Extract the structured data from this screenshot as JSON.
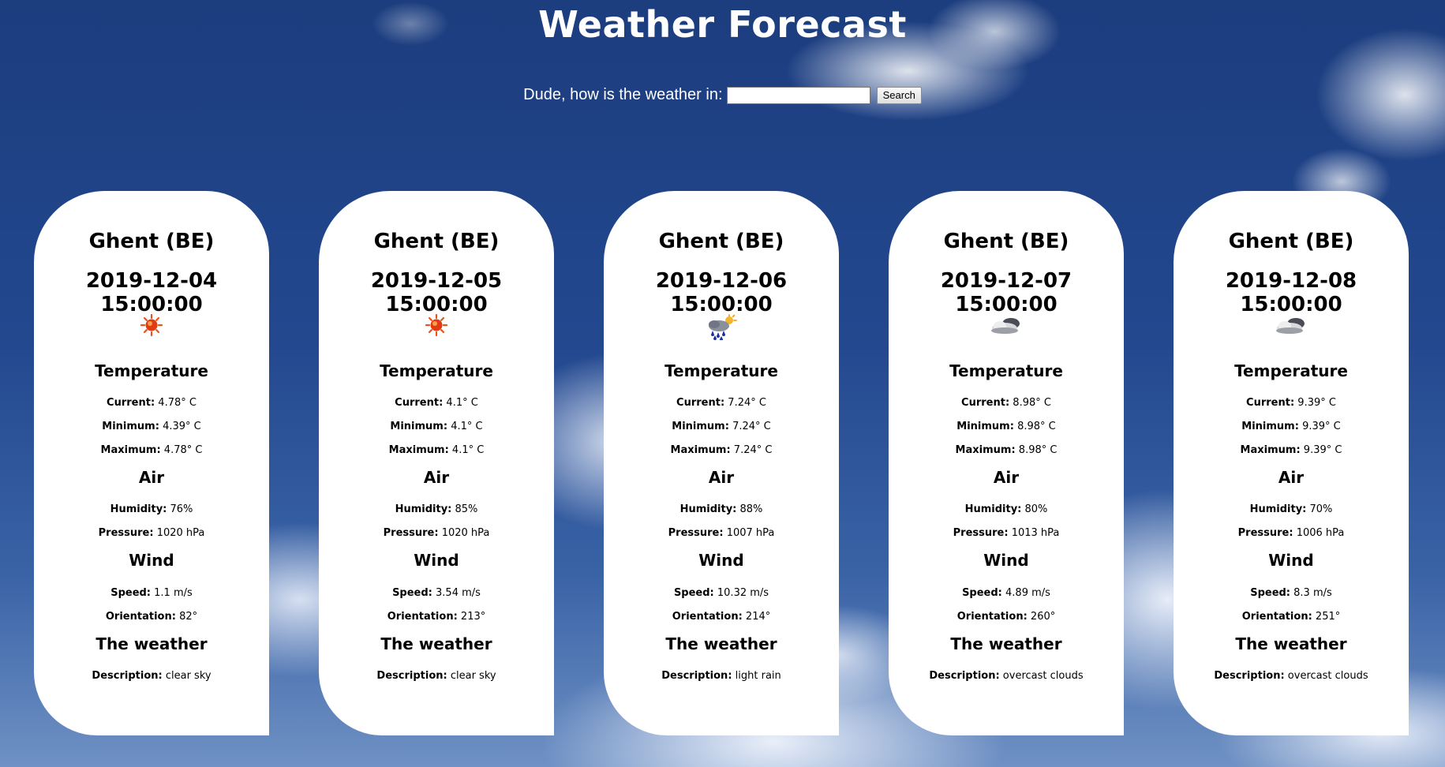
{
  "page": {
    "title": "Weather Forecast"
  },
  "search": {
    "label": "Dude, how is the weather in:",
    "value": "",
    "placeholder": "",
    "button": "Search"
  },
  "labels": {
    "temperature": "Temperature",
    "current": "Current:",
    "minimum": "Minimum:",
    "maximum": "Maximum:",
    "air": "Air",
    "humidity": "Humidity:",
    "pressure": "Pressure:",
    "wind": "Wind",
    "speed": "Speed:",
    "orientation": "Orientation:",
    "weather": "The weather",
    "description": "Description:"
  },
  "cards": [
    {
      "city": "Ghent (BE)",
      "date": "2019-12-04 15:00:00",
      "icon": "sun-icon",
      "current": "4.78° C",
      "minimum": "4.39° C",
      "maximum": "4.78° C",
      "humidity": "76%",
      "pressure": "1020 hPa",
      "speed": "1.1 m/s",
      "orientation": "82°",
      "description": "clear sky"
    },
    {
      "city": "Ghent (BE)",
      "date": "2019-12-05 15:00:00",
      "icon": "sun-icon",
      "current": "4.1° C",
      "minimum": "4.1° C",
      "maximum": "4.1° C",
      "humidity": "85%",
      "pressure": "1020 hPa",
      "speed": "3.54 m/s",
      "orientation": "213°",
      "description": "clear sky"
    },
    {
      "city": "Ghent (BE)",
      "date": "2019-12-06 15:00:00",
      "icon": "rain-sun-icon",
      "current": "7.24° C",
      "minimum": "7.24° C",
      "maximum": "7.24° C",
      "humidity": "88%",
      "pressure": "1007 hPa",
      "speed": "10.32 m/s",
      "orientation": "214°",
      "description": "light rain"
    },
    {
      "city": "Ghent (BE)",
      "date": "2019-12-07 15:00:00",
      "icon": "cloud-icon",
      "current": "8.98° C",
      "minimum": "8.98° C",
      "maximum": "8.98° C",
      "humidity": "80%",
      "pressure": "1013 hPa",
      "speed": "4.89 m/s",
      "orientation": "260°",
      "description": "overcast clouds"
    },
    {
      "city": "Ghent (BE)",
      "date": "2019-12-08 15:00:00",
      "icon": "cloud-icon",
      "current": "9.39° C",
      "minimum": "9.39° C",
      "maximum": "9.39° C",
      "humidity": "70%",
      "pressure": "1006 hPa",
      "speed": "8.3 m/s",
      "orientation": "251°",
      "description": "overcast clouds"
    }
  ]
}
